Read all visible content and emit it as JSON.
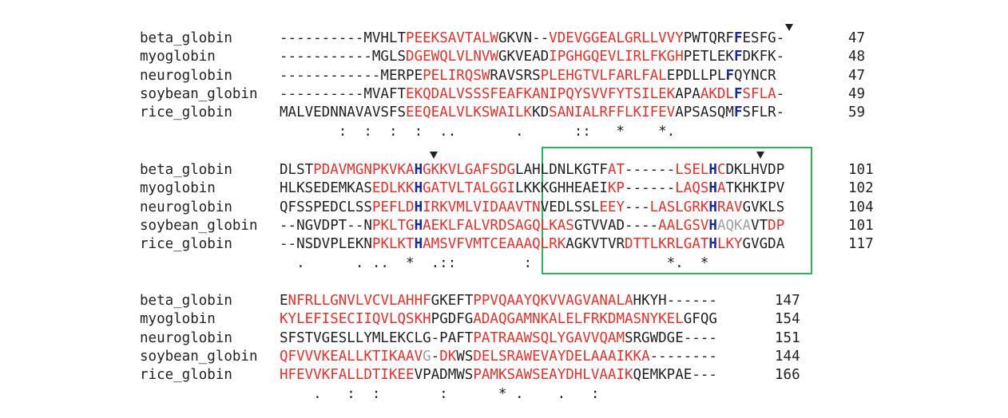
{
  "block1": {
    "names": [
      "beta_globin",
      "myoglobin",
      "neuroglobin",
      "soybean_globin",
      "rice_globin"
    ],
    "numbers": [
      "47",
      "48",
      "47",
      "49",
      "59"
    ],
    "rows": [
      [
        [
          "k",
          "----------MVHLT"
        ],
        [
          "r",
          "PEEKSAVTALW"
        ],
        [
          "k",
          "GKVN--"
        ],
        [
          "r",
          "VDEVGGEALGRLLVVY"
        ],
        [
          "k",
          "PWTQRF"
        ],
        [
          "b",
          "F"
        ],
        [
          "k",
          "ESFG-"
        ]
      ],
      [
        [
          "k",
          "-----------MGLS"
        ],
        [
          "r",
          "DGEWQLVLNVW"
        ],
        [
          "k",
          "GKVEAD"
        ],
        [
          "r",
          "IPGHGQEVLIRLFKGH"
        ],
        [
          "k",
          "PETLEK"
        ],
        [
          "b",
          "F"
        ],
        [
          "k",
          "DKFK-"
        ]
      ],
      [
        [
          "k",
          "------------MERPE"
        ],
        [
          "r",
          "PELIRQSW"
        ],
        [
          "k",
          "RAVSRS"
        ],
        [
          "r",
          "PLEHGTVLFARLFAL"
        ],
        [
          "k",
          "EPDLLPL"
        ],
        [
          "b",
          "F"
        ],
        [
          "k",
          "QYNCR"
        ]
      ],
      [
        [
          "k",
          "----------MVAFT"
        ],
        [
          "r",
          "EKQDALVSSSFEAFKA"
        ],
        [
          "r",
          "NIPQYSVVFYTSILEK"
        ],
        [
          "k",
          "APA"
        ],
        [
          "r",
          "AKDL"
        ],
        [
          "b",
          "F"
        ],
        [
          "r",
          "SFLA"
        ],
        [
          "k",
          "-"
        ]
      ],
      [
        [
          "k",
          "MALVEDNNAVAVSFS"
        ],
        [
          "r",
          "EEQEALVLKSWAILK"
        ],
        [
          "k",
          "KD"
        ],
        [
          "r",
          "SANIALRFFLKIFEV"
        ],
        [
          "k",
          "APSASQM"
        ],
        [
          "b",
          "F"
        ],
        [
          "k",
          "SFLR-"
        ]
      ]
    ],
    "consensus": "       :  :  :  :  ..       .      ::   *    *."
  },
  "block2": {
    "names": [
      "beta_globin",
      "myoglobin",
      "neuroglobin",
      "soybean_globin",
      "rice_globin"
    ],
    "numbers": [
      "101",
      "102",
      "104",
      "101",
      "117"
    ],
    "rows": [
      [
        [
          "k",
          "DLST"
        ],
        [
          "r",
          "PDAVMGNPKVKA"
        ],
        [
          "b",
          "H"
        ],
        [
          "r",
          "GKKVLGAFSDG"
        ],
        [
          "k",
          "LAHLDNLKGTF"
        ],
        [
          "r",
          "AT"
        ],
        [
          "k",
          "------"
        ],
        [
          "r",
          "LSEL"
        ],
        [
          "b",
          "H"
        ],
        [
          "r",
          "C"
        ],
        [
          "k",
          "DKLHVDP"
        ]
      ],
      [
        [
          "k",
          "HLKSEDEMKAS"
        ],
        [
          "r",
          "EDLKK"
        ],
        [
          "b",
          "H"
        ],
        [
          "r",
          "GATVLTALGGI"
        ],
        [
          "k",
          "LKKKGHHEAEI"
        ],
        [
          "r",
          "KP"
        ],
        [
          "k",
          "------"
        ],
        [
          "r",
          "LAQS"
        ],
        [
          "b",
          "H"
        ],
        [
          "r",
          "A"
        ],
        [
          "k",
          "TKHKIPV"
        ]
      ],
      [
        [
          "k",
          "QFSSPEDCLSS"
        ],
        [
          "r",
          "PEFLD"
        ],
        [
          "b",
          "H"
        ],
        [
          "r",
          "IRKVMLVIDAA"
        ],
        [
          "r",
          "VTN"
        ],
        [
          "k",
          "VEDLSSL"
        ],
        [
          "r",
          "EEY"
        ],
        [
          "k",
          "---"
        ],
        [
          "r",
          "LASLGRK"
        ],
        [
          "b",
          "H"
        ],
        [
          "r",
          "RAV"
        ],
        [
          "k",
          "GVKLS"
        ]
      ],
      [
        [
          "k",
          "--NGVDPT--N"
        ],
        [
          "r",
          "PKLTG"
        ],
        [
          "b",
          "H"
        ],
        [
          "r",
          "AEKLFALVRDS"
        ],
        [
          "r",
          "AGQLKAS"
        ],
        [
          "k",
          "GTVVAD----"
        ],
        [
          "r",
          "AALGSV"
        ],
        [
          "b",
          "H"
        ],
        [
          "g",
          "AQKA"
        ],
        [
          "k",
          "VT"
        ],
        [
          "r",
          "DP"
        ]
      ],
      [
        [
          "k",
          "--NSDVPLEKN"
        ],
        [
          "r",
          "PKLKT"
        ],
        [
          "b",
          "H"
        ],
        [
          "r",
          "AMSVFVMTCEA"
        ],
        [
          "r",
          "AAQLRK"
        ],
        [
          "k",
          "AGKVTVR"
        ],
        [
          "r",
          "DTTLKRLGAT"
        ],
        [
          "b",
          "H"
        ],
        [
          "r",
          "LKY"
        ],
        [
          "k",
          "GVGDA"
        ]
      ]
    ],
    "consensus": "  .      . ..  *  .::        :                *.  *"
  },
  "block3": {
    "names": [
      "beta_globin",
      "myoglobin",
      "neuroglobin",
      "soybean_globin",
      "rice_globin"
    ],
    "numbers": [
      "147",
      "154",
      "151",
      "144",
      "166"
    ],
    "rows": [
      [
        [
          "k",
          "E"
        ],
        [
          "r",
          "NFRLLGNVLVCVLAHHF"
        ],
        [
          "k",
          "GKEFT"
        ],
        [
          "r",
          "PPVQAAYQKVVAGVANALA"
        ],
        [
          "k",
          "HKYH------"
        ]
      ],
      [
        [
          "r",
          "KYLEFISECIIQVLQSKH"
        ],
        [
          "k",
          "PGDFG"
        ],
        [
          "r",
          "ADAQGAMNKALELFRKDMASNYKEL"
        ],
        [
          "k",
          "GFQG"
        ]
      ],
      [
        [
          "k",
          "SFSTVGESLLYMLEKCLG-PAFT"
        ],
        [
          "r",
          "PATRAAWSQLYGAVVQAM"
        ],
        [
          "k",
          "SRGWDGE----"
        ]
      ],
      [
        [
          "r",
          "QFVVVKEALLKTIKAAV"
        ],
        [
          "g",
          "G"
        ],
        [
          "k",
          "-"
        ],
        [
          "r",
          "DK"
        ],
        [
          "k",
          "WS"
        ],
        [
          "r",
          "DELSRAWEVAYDELAAAIKKA"
        ],
        [
          "k",
          "--------"
        ]
      ],
      [
        [
          "r",
          "HFEVVKFALLDTIKEE"
        ],
        [
          "k",
          "VPADMWS"
        ],
        [
          "r",
          "PAMKSAWSEAYDHLVAAIK"
        ],
        [
          "k",
          "QEMKPAE---"
        ]
      ]
    ],
    "consensus": "    .   :  :       :      * .    .   :"
  },
  "annotations": {
    "marker_color": "#222222",
    "box_color": "#2db35a",
    "residue_colors": {
      "red": "#e8302a",
      "blue": "#1428a0",
      "gray": "#a0a0a0",
      "black": "#222222"
    }
  }
}
